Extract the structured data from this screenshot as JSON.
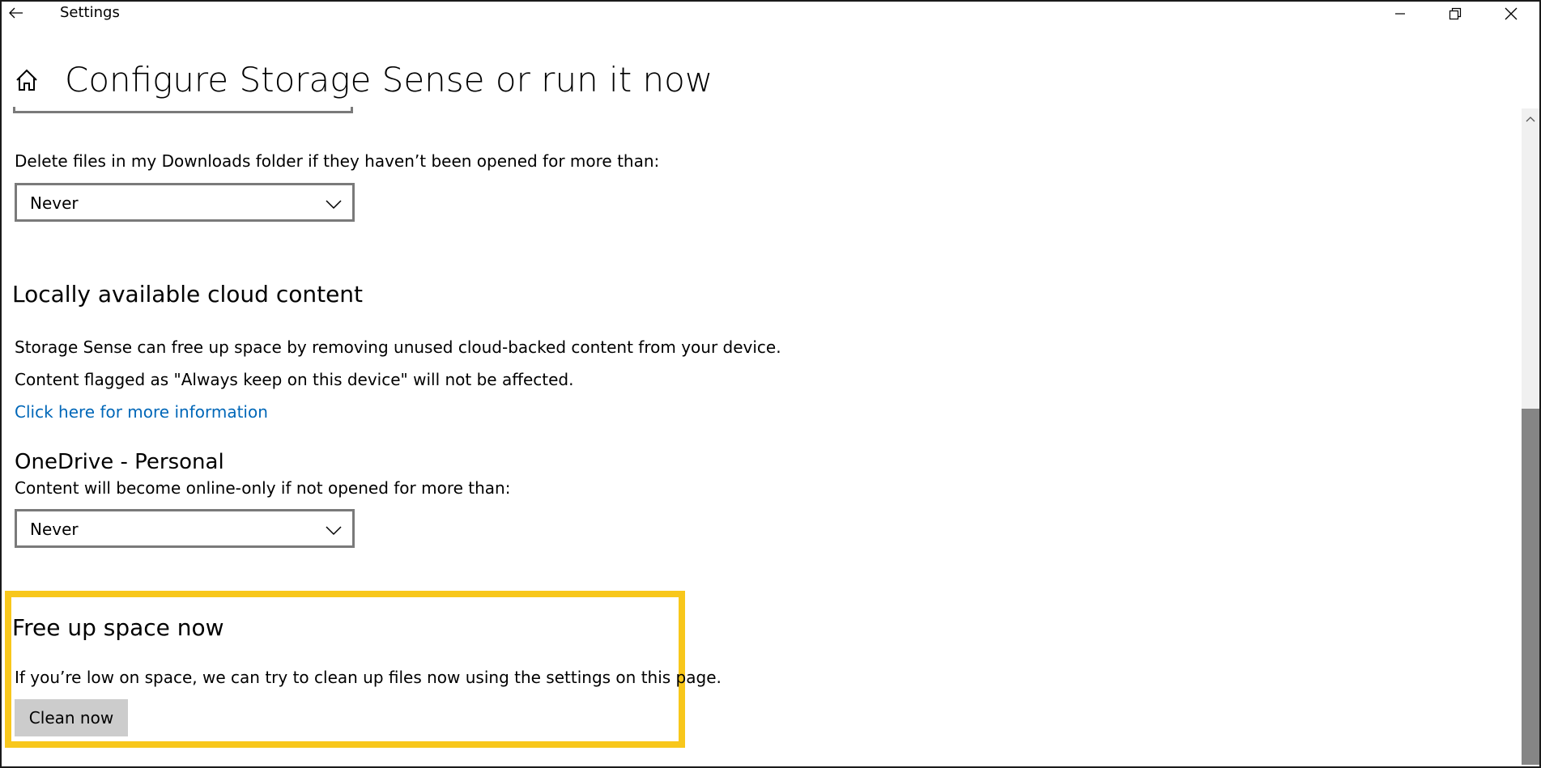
{
  "window": {
    "title": "Settings"
  },
  "icons": {
    "back": "back-arrow-icon",
    "home": "home-icon",
    "minimize": "minimize-icon",
    "maximize": "restore-icon",
    "close": "close-icon",
    "chevron": "chevron-down-icon",
    "scroll_up": "chevron-up-icon"
  },
  "page": {
    "title": "Configure Storage Sense or run it now"
  },
  "downloads": {
    "label": "Delete files in my Downloads folder if they haven’t been opened for more than:",
    "selected": "Never"
  },
  "cloud": {
    "heading": "Locally available cloud content",
    "desc1": "Storage Sense can free up space by removing unused cloud-backed content from your device.",
    "desc2": "Content flagged as \"Always keep on this device\" will not be affected.",
    "link": "Click here for more information"
  },
  "onedrive": {
    "heading": "OneDrive - Personal",
    "label": "Content will become online-only if not opened for more than:",
    "selected": "Never"
  },
  "free_space": {
    "heading": "Free up space now",
    "desc": "If you’re low on space, we can try to clean up files now using the settings on this page.",
    "button": "Clean now"
  },
  "colors": {
    "link": "#0067b8",
    "highlight": "#f8c71b",
    "button_bg": "#cccccc",
    "scroll_thumb": "#858585"
  }
}
